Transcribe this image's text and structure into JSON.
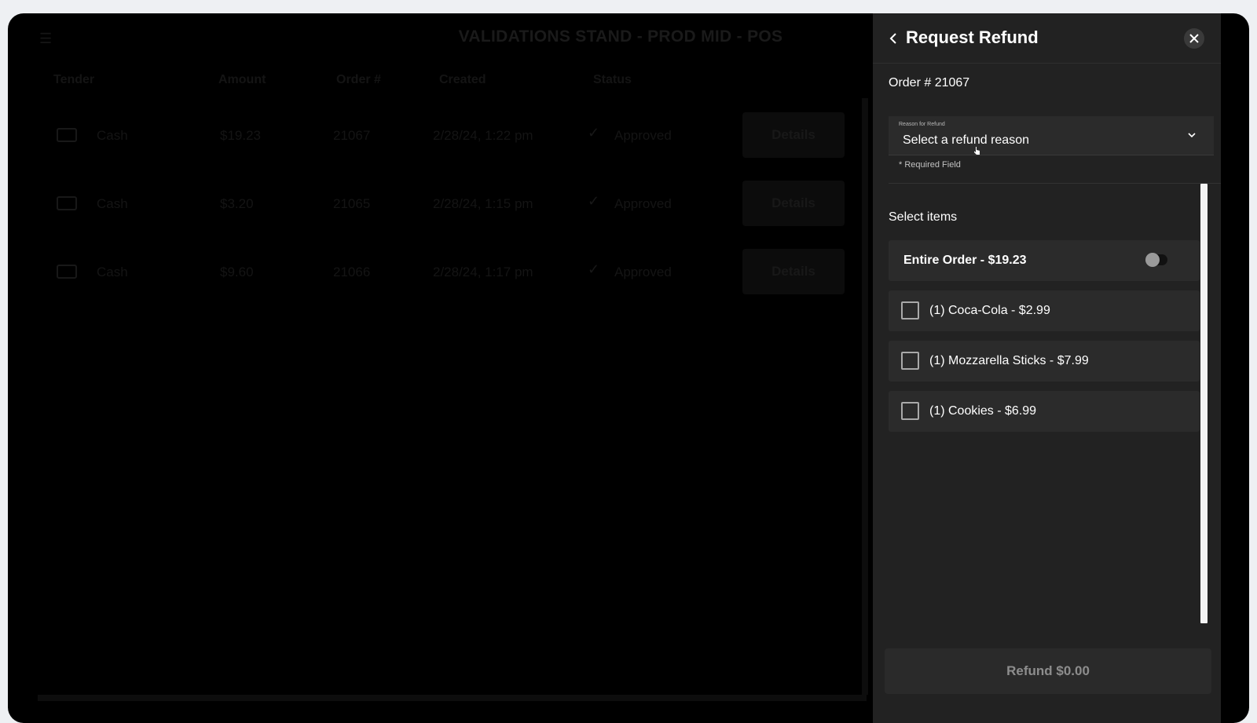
{
  "background": {
    "title": "VALIDATIONS STAND - PROD MID - POS",
    "menu_icon": "hamburger-menu-icon",
    "columns": [
      "Tender",
      "Amount",
      "Order #",
      "Created",
      "Status"
    ],
    "rows": [
      {
        "tender": "Cash",
        "amount": "$19.23",
        "order": "21067",
        "created": "2/28/24, 1:22 pm",
        "status": "Approved",
        "action": "Details"
      },
      {
        "tender": "Cash",
        "amount": "$3.20",
        "order": "21065",
        "created": "2/28/24, 1:15 pm",
        "status": "Approved",
        "action": "Details"
      },
      {
        "tender": "Cash",
        "amount": "$9.60",
        "order": "21066",
        "created": "2/28/24, 1:17 pm",
        "status": "Approved",
        "action": "Details"
      }
    ]
  },
  "panel": {
    "title": "Request Refund",
    "back_icon": "chevron-left-icon",
    "close_icon": "close-icon",
    "order_label": "Order # 21067",
    "reason": {
      "label": "Reason for Refund",
      "value": "Select a refund reason",
      "required_note": "* Required Field"
    },
    "select_items_label": "Select items",
    "entire_order": {
      "label": "Entire Order - $19.23",
      "toggled": false
    },
    "items": [
      {
        "label": "(1) Coca-Cola - $2.99",
        "checked": false
      },
      {
        "label": "(1) Mozzarella Sticks - $7.99",
        "checked": false
      },
      {
        "label": "(1) Cookies - $6.99",
        "checked": false
      }
    ],
    "refund_button": "Refund $0.00"
  },
  "colors": {
    "panel_bg": "#222222",
    "row_bg": "#2b2b2b",
    "overlay": "#000000",
    "disabled_text": "#8d8d8d"
  }
}
